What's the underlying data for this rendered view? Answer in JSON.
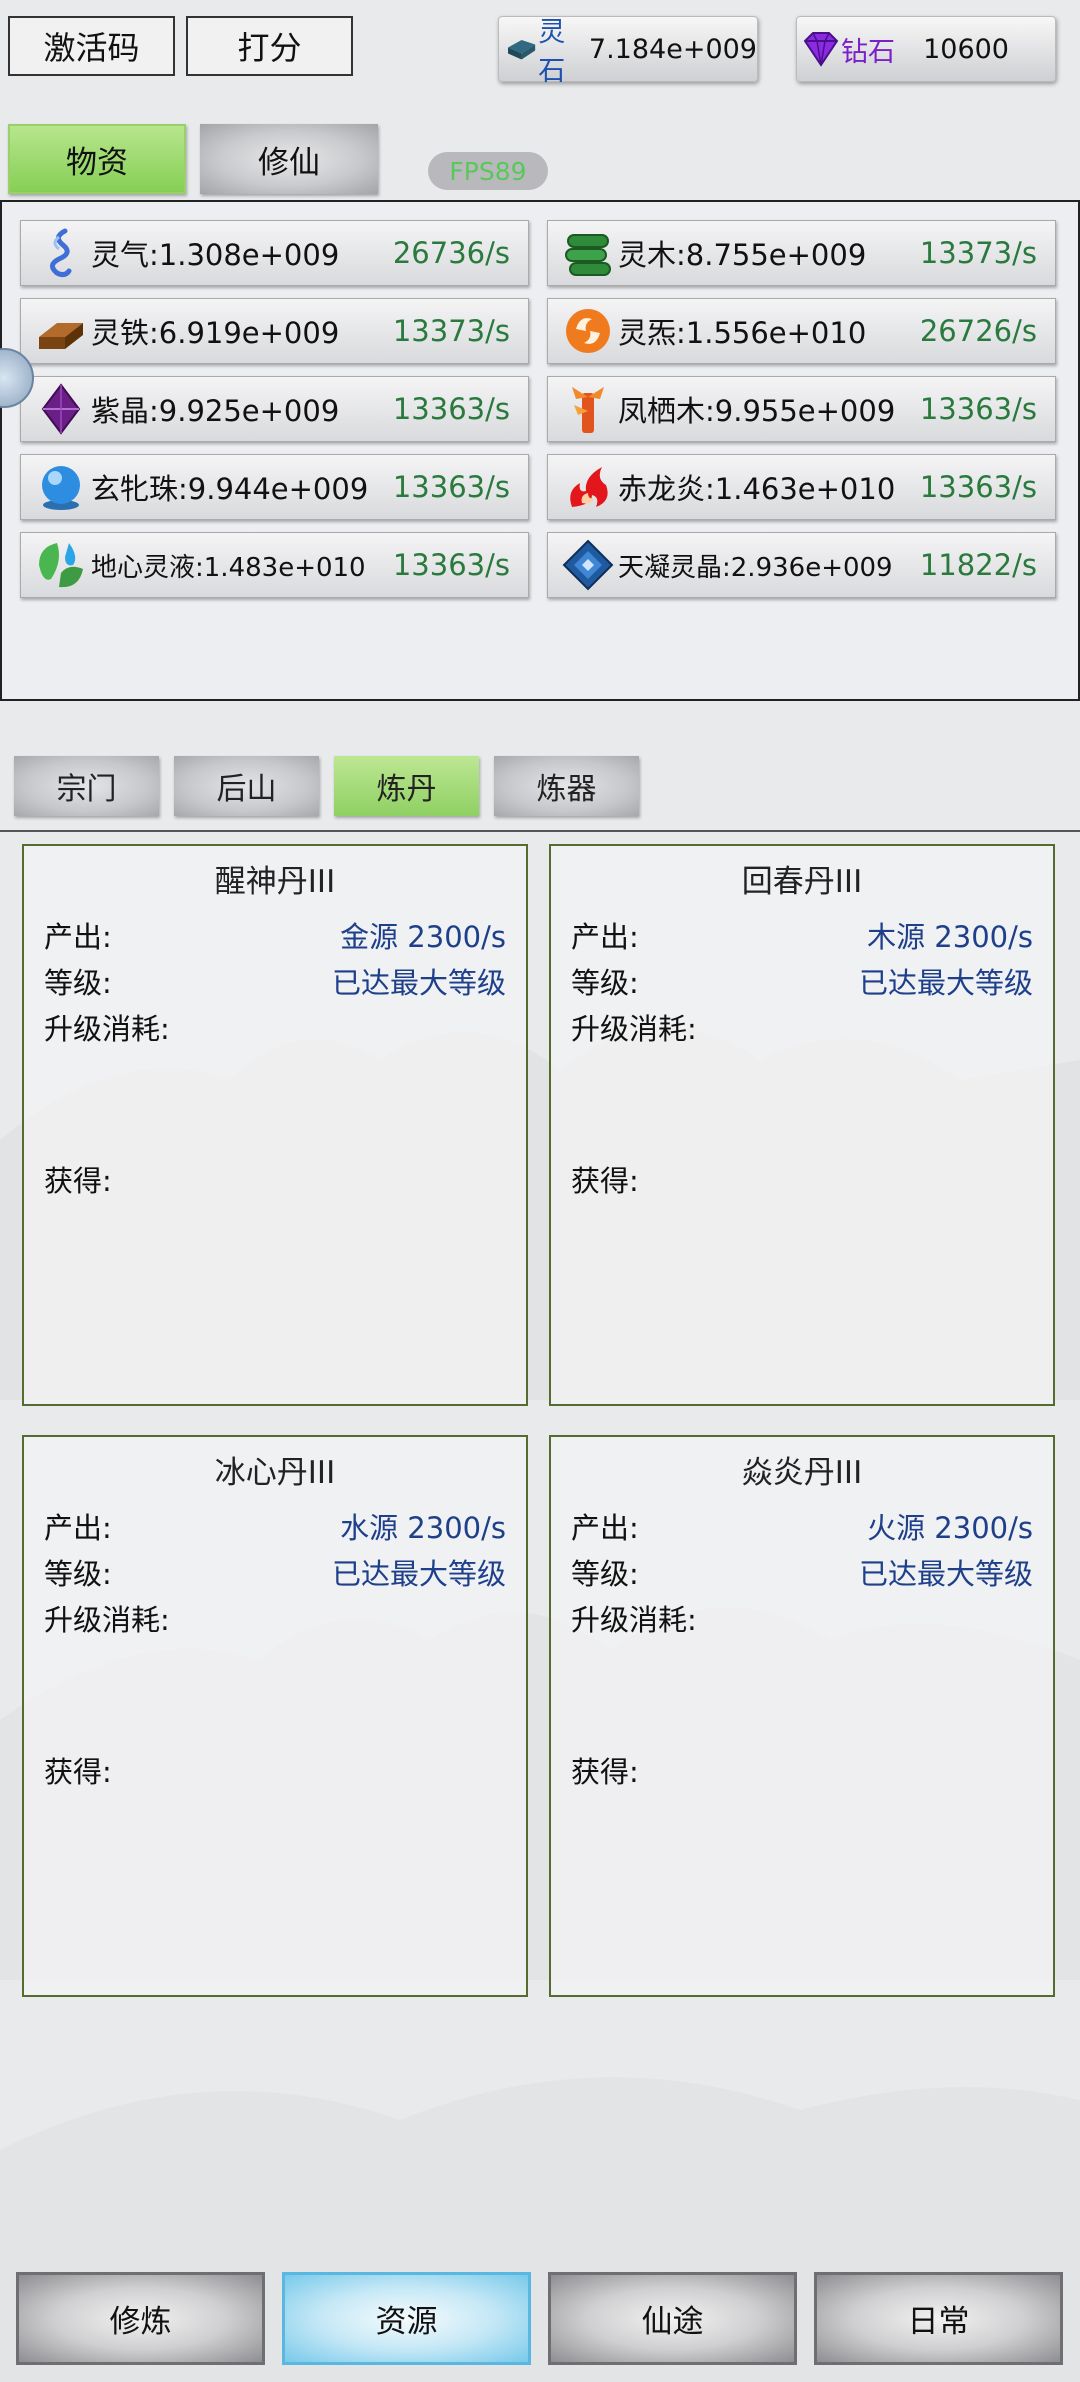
{
  "top_buttons": {
    "activation_code": "激活码",
    "rate": "打分"
  },
  "currency": {
    "lingshi": {
      "label": "灵石",
      "value": "7.184e+009"
    },
    "zuanshi": {
      "label": "钻石",
      "value": "10600"
    }
  },
  "main_tabs": [
    {
      "label": "物资",
      "active": true
    },
    {
      "label": "修仙",
      "active": false
    }
  ],
  "fps_label": "FPS89",
  "resources": [
    {
      "name": "灵气:1.308e+009",
      "rate": "26736/s",
      "icon": "qi-swirl-icon"
    },
    {
      "name": "灵木:8.755e+009",
      "rate": "13373/s",
      "icon": "wood-scroll-icon"
    },
    {
      "name": "灵铁:6.919e+009",
      "rate": "13373/s",
      "icon": "iron-ingot-icon"
    },
    {
      "name": "灵炁:1.556e+010",
      "rate": "26726/s",
      "icon": "orange-swirl-icon"
    },
    {
      "name": "紫晶:9.925e+009",
      "rate": "13363/s",
      "icon": "purple-crystal-icon"
    },
    {
      "name": "凤栖木:9.955e+009",
      "rate": "13363/s",
      "icon": "phoenix-wood-icon"
    },
    {
      "name": "玄牝珠:9.944e+009",
      "rate": "13363/s",
      "icon": "blue-orb-icon"
    },
    {
      "name": "赤龙炎:1.463e+010",
      "rate": "13363/s",
      "icon": "red-flame-icon"
    },
    {
      "name": "地心灵液:1.483e+010",
      "rate": "13363/s",
      "icon": "water-leaf-icon"
    },
    {
      "name": "天凝灵晶:2.936e+009",
      "rate": "11822/s",
      "icon": "blue-diamond-icon"
    }
  ],
  "sub_tabs": [
    {
      "label": "宗门",
      "active": false
    },
    {
      "label": "后山",
      "active": false
    },
    {
      "label": "炼丹",
      "active": true
    },
    {
      "label": "炼器",
      "active": false
    }
  ],
  "card_labels": {
    "output": "产出:",
    "level": "等级:",
    "upgrade_cost": "升级消耗:",
    "gain": "获得:"
  },
  "pills": [
    {
      "title": "醒神丹III",
      "output": "金源 2300/s",
      "level": "已达最大等级"
    },
    {
      "title": "回春丹III",
      "output": "木源 2300/s",
      "level": "已达最大等级"
    },
    {
      "title": "冰心丹III",
      "output": "水源 2300/s",
      "level": "已达最大等级"
    },
    {
      "title": "焱炎丹III",
      "output": "火源 2300/s",
      "level": "已达最大等级"
    }
  ],
  "bottom_nav": [
    {
      "label": "修炼",
      "active": false
    },
    {
      "label": "资源",
      "active": true
    },
    {
      "label": "仙途",
      "active": false
    },
    {
      "label": "日常",
      "active": false
    }
  ],
  "colors": {
    "rate_green": "#2a7a3d",
    "value_blue": "#1e3f8a",
    "tab_green": "#8fd063",
    "nav_active": "#78c9ea"
  }
}
